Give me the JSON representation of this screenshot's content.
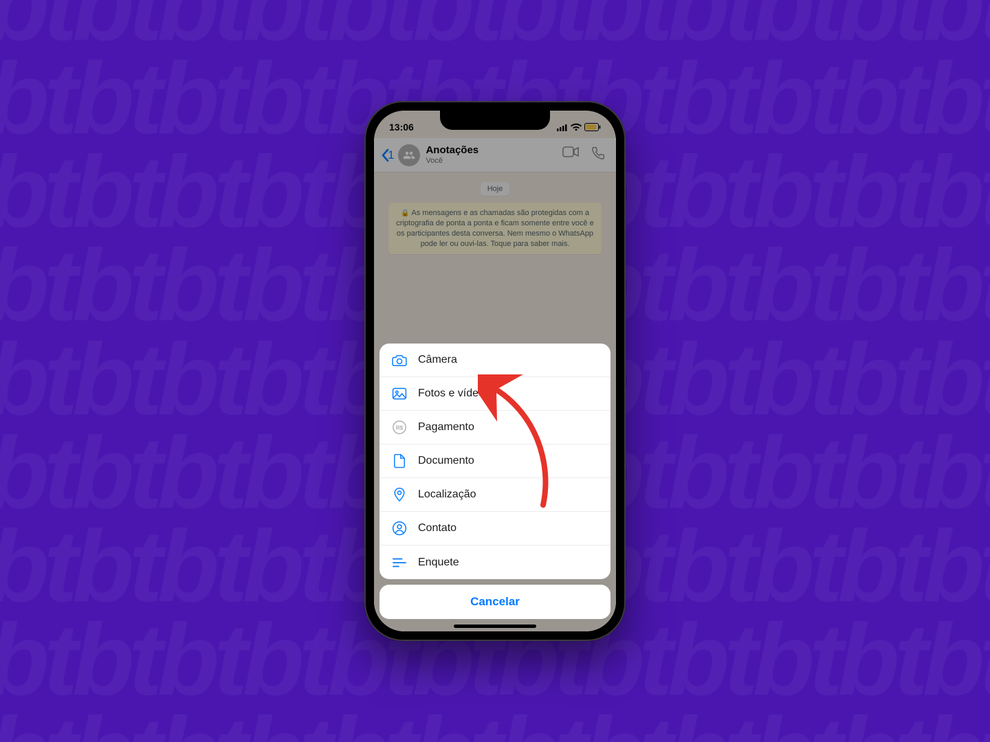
{
  "statusbar": {
    "time": "13:06"
  },
  "header": {
    "back_count": "1",
    "title": "Anotações",
    "subtitle": "Você"
  },
  "chat": {
    "date_label": "Hoje",
    "encryption_note": "As mensagens e as chamadas são protegidas com a criptografia de ponta a ponta e ficam somente entre você e os participantes desta conversa. Nem mesmo o WhatsApp pode ler ou ouvi-las. Toque para saber mais."
  },
  "sheet": {
    "items": {
      "camera": {
        "label": "Câmera"
      },
      "photos": {
        "label": "Fotos e vídeos"
      },
      "payment": {
        "label": "Pagamento"
      },
      "document": {
        "label": "Documento"
      },
      "location": {
        "label": "Localização"
      },
      "contact": {
        "label": "Contato"
      },
      "poll": {
        "label": "Enquete"
      }
    },
    "cancel_label": "Cancelar"
  }
}
